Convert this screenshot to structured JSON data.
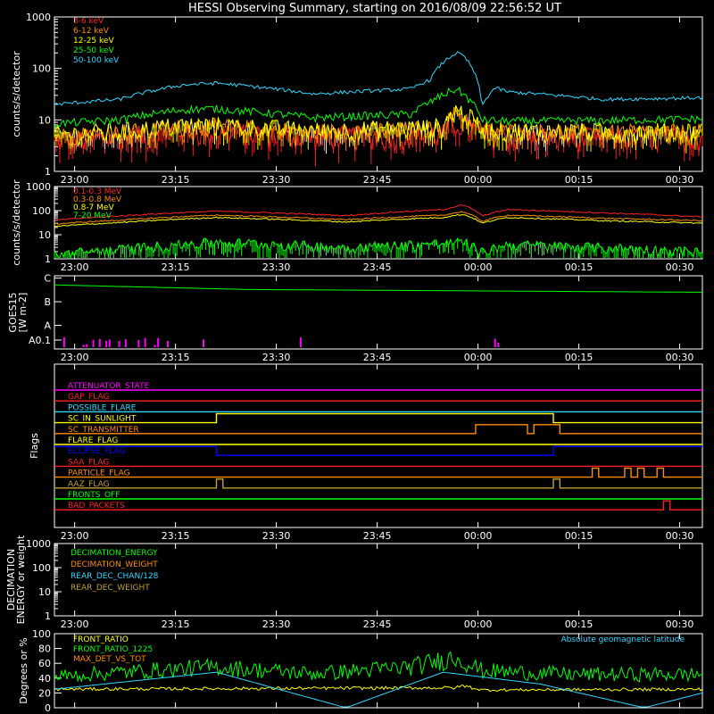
{
  "title": "HESSI Observing Summary, starting on 2016/08/09 22:56:52 UT",
  "x_ticks": [
    "23:00",
    "23:15",
    "23:30",
    "23:45",
    "00:00",
    "00:15",
    "00:30"
  ],
  "colors": {
    "red": "#ff2020",
    "orange": "#ff8c00",
    "yellow": "#ffff00",
    "green": "#00ff00",
    "cyan": "#30d8ff",
    "magenta": "#ff00ff",
    "blue": "#0000ff",
    "olive": "#c0a030",
    "white": "#ffffff"
  },
  "chart_data": [
    {
      "id": "hxr",
      "type": "line",
      "ylabel": "counts/s/detector",
      "yscale": "log",
      "ylim": [
        1,
        1000
      ],
      "yticks": [
        "1",
        "10",
        "100",
        "1000"
      ],
      "series": [
        {
          "name": "3-6 keV",
          "color": "red",
          "x": [
            0,
            10,
            20,
            25,
            40,
            60,
            62,
            66,
            70,
            85,
            100
          ],
          "values": [
            4,
            4.6,
            6,
            6.1,
            4.8,
            5.5,
            9,
            5.3,
            4.9,
            4.5,
            4.8
          ]
        },
        {
          "name": "6-12 keV",
          "color": "orange",
          "x": [
            0,
            10,
            20,
            25,
            40,
            60,
            62,
            66,
            70,
            85,
            100
          ],
          "values": [
            5,
            5.8,
            7.5,
            7.8,
            6,
            7,
            14,
            6.5,
            6.2,
            5.8,
            6
          ]
        },
        {
          "name": "12-25 keV",
          "color": "yellow",
          "x": [
            0,
            10,
            20,
            25,
            40,
            60,
            62,
            66,
            70,
            85,
            100
          ],
          "values": [
            5.2,
            6,
            8,
            8,
            6.2,
            7.4,
            16,
            6.8,
            6.3,
            6,
            6.2
          ]
        },
        {
          "name": "25-50 keV",
          "color": "green",
          "x": [
            0,
            10,
            20,
            25,
            40,
            55,
            58,
            62,
            66,
            70,
            85,
            100
          ],
          "values": [
            8.5,
            10,
            16,
            16.5,
            11,
            13,
            22,
            40,
            10,
            9.5,
            9.8,
            10.5
          ]
        },
        {
          "name": "50-100 keV",
          "color": "cyan",
          "x": [
            0,
            10,
            20,
            25,
            40,
            55,
            58,
            62,
            63,
            66,
            68,
            70,
            85,
            100
          ],
          "values": [
            20,
            25,
            48,
            52,
            32,
            40,
            60,
            200,
            180,
            18,
            42,
            35,
            25,
            27
          ]
        }
      ]
    },
    {
      "id": "gamma",
      "type": "line",
      "ylabel": "counts/s/detector",
      "yscale": "log",
      "ylim": [
        1,
        1000
      ],
      "yticks": [
        "1",
        "10",
        "100",
        "1000"
      ],
      "series": [
        {
          "name": "0.1-0.3 MeV",
          "color": "red",
          "x": [
            0,
            10,
            25,
            45,
            60,
            63,
            66,
            70,
            85,
            100
          ],
          "values": [
            40,
            60,
            95,
            62,
            110,
            170,
            60,
            110,
            80,
            55
          ]
        },
        {
          "name": "0.3-0.8 MeV",
          "color": "orange",
          "x": [
            0,
            10,
            25,
            45,
            60,
            63,
            66,
            70,
            85,
            100
          ],
          "values": [
            28,
            40,
            65,
            42,
            65,
            90,
            36,
            65,
            48,
            38
          ]
        },
        {
          "name": "0.8-7 MeV",
          "color": "yellow",
          "x": [
            0,
            10,
            25,
            45,
            60,
            63,
            66,
            70,
            85,
            100
          ],
          "values": [
            22,
            32,
            52,
            34,
            52,
            70,
            30,
            52,
            38,
            30
          ]
        },
        {
          "name": "7-20 MeV",
          "color": "green",
          "x": [
            0,
            10,
            25,
            45,
            60,
            63,
            66,
            70,
            85,
            100
          ],
          "values": [
            1.5,
            2.5,
            5,
            3,
            4.5,
            5,
            1.8,
            4,
            3,
            2
          ]
        }
      ]
    },
    {
      "id": "goes",
      "type": "line",
      "ylabel": "GOES15 [W m-2]",
      "ylim": [
        0,
        4
      ],
      "yticks": [
        "A0.1",
        "A",
        "B",
        "C"
      ],
      "series": [
        {
          "name": "goes",
          "color": "green",
          "x": [
            0,
            30,
            100
          ],
          "values": [
            3.5,
            3.25,
            3.1
          ]
        }
      ]
    },
    {
      "id": "flags",
      "type": "line",
      "ylabel": "Flags",
      "series": [
        {
          "name": "ATTENUATOR_STATE",
          "color": "magenta",
          "segments": []
        },
        {
          "name": "GAP_FLAG",
          "color": "red",
          "segments": []
        },
        {
          "name": "POSSIBLE_FLARE",
          "color": "cyan",
          "segments": []
        },
        {
          "name": "SC_IN_SUNLIGHT",
          "color": "yellow",
          "segments": [
            [
              0,
              25,
              0
            ],
            [
              25,
              77,
              1
            ],
            [
              77,
              100,
              0
            ]
          ]
        },
        {
          "name": "SC_TRANSMITTER",
          "color": "orange",
          "segments": [
            [
              0,
              65,
              0
            ],
            [
              65,
              73,
              1
            ],
            [
              73,
              74,
              0
            ],
            [
              74,
              78,
              1
            ],
            [
              78,
              100,
              0
            ]
          ]
        },
        {
          "name": "FLARE_FLAG",
          "color": "yellow",
          "segments": []
        },
        {
          "name": "ECLIPSE_FLAG",
          "color": "blue",
          "segments": [
            [
              0,
              25,
              1
            ],
            [
              25,
              77,
              0
            ],
            [
              77,
              100,
              1
            ]
          ]
        },
        {
          "name": "SAA_FLAG",
          "color": "red",
          "segments": []
        },
        {
          "name": "PARTICLE_FLAG",
          "color": "orange",
          "segments": [
            [
              0,
              83,
              0
            ],
            [
              83,
              84,
              1
            ],
            [
              84,
              88,
              0
            ],
            [
              88,
              89,
              1
            ],
            [
              89,
              90,
              0
            ],
            [
              90,
              91,
              1
            ],
            [
              91,
              93,
              0
            ],
            [
              93,
              94,
              1
            ],
            [
              94,
              100,
              0
            ]
          ]
        },
        {
          "name": "AAZ_FLAG",
          "color": "olive",
          "segments": [
            [
              0,
              25,
              0
            ],
            [
              25,
              26,
              1
            ],
            [
              26,
              77,
              0
            ],
            [
              77,
              78,
              1
            ],
            [
              78,
              100,
              0
            ]
          ]
        },
        {
          "name": "FRONTS_OFF",
          "color": "green",
          "segments": []
        },
        {
          "name": "BAD_PACKETS",
          "color": "red",
          "segments": [
            [
              0,
              94,
              0
            ],
            [
              94,
              95,
              1
            ],
            [
              95,
              100,
              0
            ]
          ]
        }
      ]
    },
    {
      "id": "decimation",
      "type": "line",
      "ylabel": "DECIMATION ENERGY or weight",
      "yscale": "log",
      "ylim": [
        1,
        1000
      ],
      "yticks": [
        "1",
        "10",
        "100",
        "1000"
      ],
      "series": [
        {
          "name": "DECIMATION_ENERGY",
          "color": "green",
          "values": []
        },
        {
          "name": "DECIMATION_WEIGHT",
          "color": "orange",
          "values": []
        },
        {
          "name": "REAR_DEC_CHAN/128",
          "color": "cyan",
          "values": []
        },
        {
          "name": "REAR_DEC_WEIGHT",
          "color": "olive",
          "values": []
        }
      ]
    },
    {
      "id": "ratios",
      "type": "line",
      "ylabel": "Degrees or %",
      "ylim": [
        0,
        100
      ],
      "yticks": [
        "0",
        "20",
        "40",
        "60",
        "80",
        "100"
      ],
      "annotation": "Absolute geomagnetic latitude",
      "series": [
        {
          "name": "FRONT_RATIO",
          "color": "yellow",
          "x": [
            0,
            62,
            63,
            66,
            100
          ],
          "values": [
            25,
            27,
            30,
            24,
            25
          ]
        },
        {
          "name": "FRONT_RATIO_1225",
          "color": "green",
          "x": [
            0,
            10,
            25,
            40,
            55,
            62,
            66,
            80,
            100
          ],
          "values": [
            42,
            48,
            55,
            46,
            55,
            68,
            50,
            45,
            45
          ]
        },
        {
          "name": "MAX_DET_VS_TOT",
          "color": "orange",
          "values": []
        },
        {
          "name": "Absolute geomagnetic latitude",
          "color": "cyan",
          "x": [
            0,
            25,
            45,
            60,
            75,
            91,
            100
          ],
          "values": [
            25,
            48,
            0,
            48,
            32,
            0,
            20
          ]
        }
      ]
    }
  ]
}
